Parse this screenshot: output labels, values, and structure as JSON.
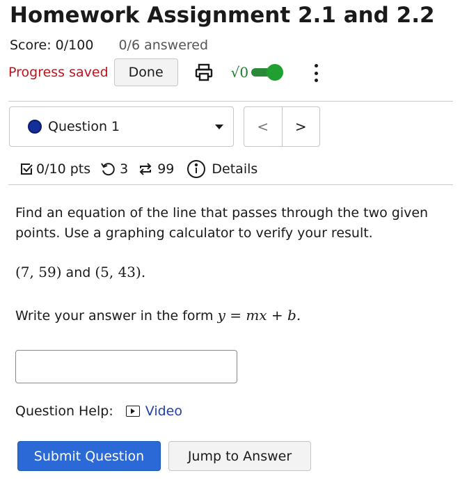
{
  "header": {
    "title": "Homework Assignment 2.1 and 2.2",
    "score": "Score: 0/100",
    "answered": "0/6 answered"
  },
  "toolbar": {
    "status": "Progress saved",
    "done_label": "Done",
    "math_toggle_label": "√0",
    "math_toggle_on": true,
    "icons": [
      "print-icon",
      "more-vertical-icon"
    ]
  },
  "question_nav": {
    "selected": "Question 1",
    "prev_label": "<",
    "next_label": ">"
  },
  "meta": {
    "points": "0/10 pts",
    "retries": "3",
    "attempts": "99",
    "details_label": "Details"
  },
  "problem": {
    "text": "Find an equation of the line that passes through the two given points. Use a graphing calculator to verify your result.",
    "point1": "(7, 59)",
    "conjunction": "and",
    "point2": "(5, 43).",
    "form_prefix": "Write your answer in the form",
    "form_math": "y = mx + b."
  },
  "answer": {
    "value": "",
    "placeholder": ""
  },
  "help": {
    "label": "Question Help:",
    "video_label": "Video"
  },
  "actions": {
    "submit_label": "Submit Question",
    "jump_label": "Jump to Answer"
  },
  "colors": {
    "status_red": "#c0141c",
    "toggle_green": "#1fa030",
    "question_dot": "#122f9a",
    "link_blue": "#1f3fb0",
    "submit_blue": "#2a69d6"
  }
}
